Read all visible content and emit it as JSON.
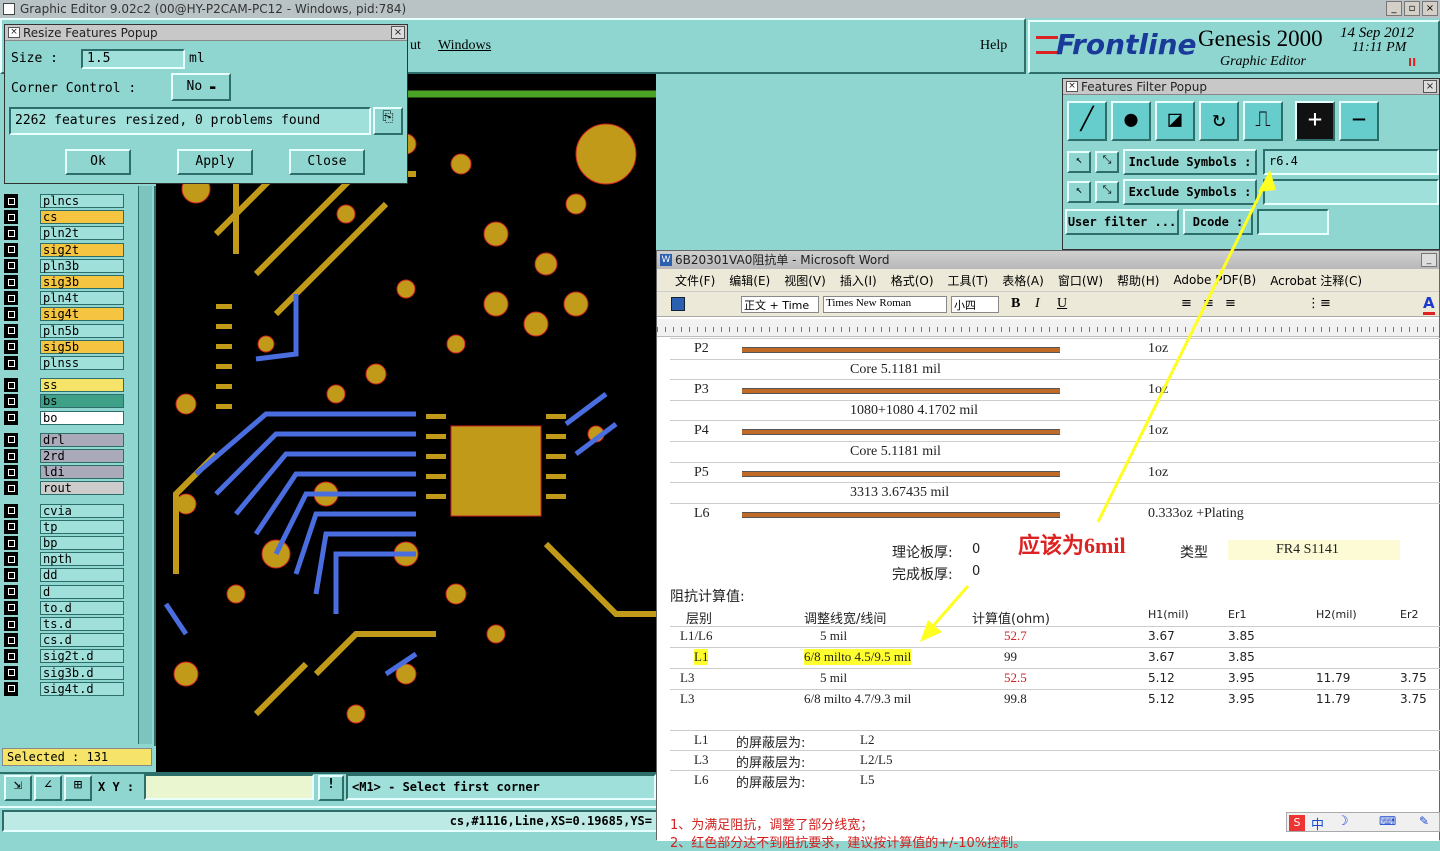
{
  "title_bar": "Graphic Editor 9.02c2 (00@HY-P2CAM-PC12 - Windows, pid:784)",
  "menu": {
    "partial": "ut",
    "windows": "Windows",
    "help": "Help"
  },
  "logo": {
    "brand": "Frontline",
    "product": "Genesis 2000",
    "subtitle": "Graphic Editor",
    "date": "14 Sep 2012",
    "time": "11:11 PM",
    "marker": "II"
  },
  "resize_popup": {
    "title": "Resize Features Popup",
    "size_label": "Size :",
    "size_value": "1.5",
    "size_unit": "ml",
    "corner_label": "Corner Control :",
    "corner_value": "No",
    "status": "2262 features resized, 0 problems found",
    "ok": "Ok",
    "apply": "Apply",
    "close": "Close"
  },
  "filter_popup": {
    "title": "Features Filter Popup",
    "include_label": "Include Symbols :",
    "include_value": "r6.4",
    "exclude_label": "Exclude Symbols :",
    "exclude_value": "",
    "user_filter": "User filter ...",
    "dcode": "Dcode :"
  },
  "layers": [
    "plncs",
    "cs",
    "pln2t",
    "sig2t",
    "pln3b",
    "sig3b",
    "pln4t",
    "sig4t",
    "pln5b",
    "sig5b",
    "plnss",
    "ss",
    "bs",
    "bo",
    "drl",
    "2rd",
    "ldi",
    "rout",
    "cvia",
    "tp",
    "bp",
    "npth",
    "dd",
    "d",
    "to.d",
    "ts.d",
    "cs.d",
    "sig2t.d",
    "sig3b.d",
    "sig4t.d"
  ],
  "selected": "Selected : 131",
  "xy_label": "X Y :",
  "prompt": "<M1> - Select first corner",
  "status_line": "cs,#1116,Line,XS=0.19685,YS=",
  "annotation": "应该为6mil",
  "word": {
    "title": "6B20301VA0阻抗单 - Microsoft Word",
    "menus": [
      "文件(F)",
      "编辑(E)",
      "视图(V)",
      "插入(I)",
      "格式(O)",
      "工具(T)",
      "表格(A)",
      "窗口(W)",
      "帮助(H)",
      "Adobe PDF(B)",
      "Acrobat 注释(C)"
    ],
    "style": "正文 + Time",
    "font": "Times New Roman",
    "size": "小四",
    "stack": [
      {
        "layer": "P2",
        "thk": "1oz"
      },
      {
        "desc": "Core    5.1181 mil"
      },
      {
        "layer": "P3",
        "thk": "1oz"
      },
      {
        "desc": "1080+1080     4.1702 mil"
      },
      {
        "layer": "P4",
        "thk": "1oz"
      },
      {
        "desc": "Core    5.1181 mil"
      },
      {
        "layer": "P5",
        "thk": "1oz"
      },
      {
        "desc": "3313     3.67435 mil"
      },
      {
        "layer": "L6",
        "thk": "0.333oz +Plating"
      }
    ],
    "theory_label": "理论板厚:",
    "theory_value": "0",
    "finish_label": "完成板厚:",
    "finish_value": "0",
    "type_label": "类型",
    "type_value": "FR4 S1141",
    "imp_label": "阻抗计算值:",
    "headers": [
      "层别",
      "调整线宽/线间",
      "计算值(ohm)",
      "H1(mil)",
      "Er1",
      "H2(mil)",
      "Er2"
    ],
    "rows": [
      {
        "layer": "L1/L6",
        "width": "5 mil",
        "val": "52.7",
        "h1": "3.67",
        "er1": "3.85",
        "h2": "",
        "er2": ""
      },
      {
        "layer": "L1",
        "width": "6/8 milto 4.5/9.5 mil",
        "val": "99",
        "h1": "3.67",
        "er1": "3.85",
        "h2": "",
        "er2": ""
      },
      {
        "layer": "L3",
        "width": "5 mil",
        "val": "52.5",
        "h1": "5.12",
        "er1": "3.95",
        "h2": "11.79",
        "er2": "3.75"
      },
      {
        "layer": "L3",
        "width": "6/8 milto 4.7/9.3 mil",
        "val": "99.8",
        "h1": "5.12",
        "er1": "3.95",
        "h2": "11.79",
        "er2": "3.75"
      }
    ],
    "shields": [
      {
        "layer": "L1",
        "label": "的屏蔽层为:",
        "value": "L2"
      },
      {
        "layer": "L3",
        "label": "的屏蔽层为:",
        "value": "L2/L5"
      },
      {
        "layer": "L6",
        "label": "的屏蔽层为:",
        "value": "L5"
      }
    ],
    "note1": "1、为满足阻抗，调整了部分线宽；",
    "note2": "2、红色部分达不到阻抗要求，建议按计算值的+/-10%控制。",
    "ime": "中"
  }
}
